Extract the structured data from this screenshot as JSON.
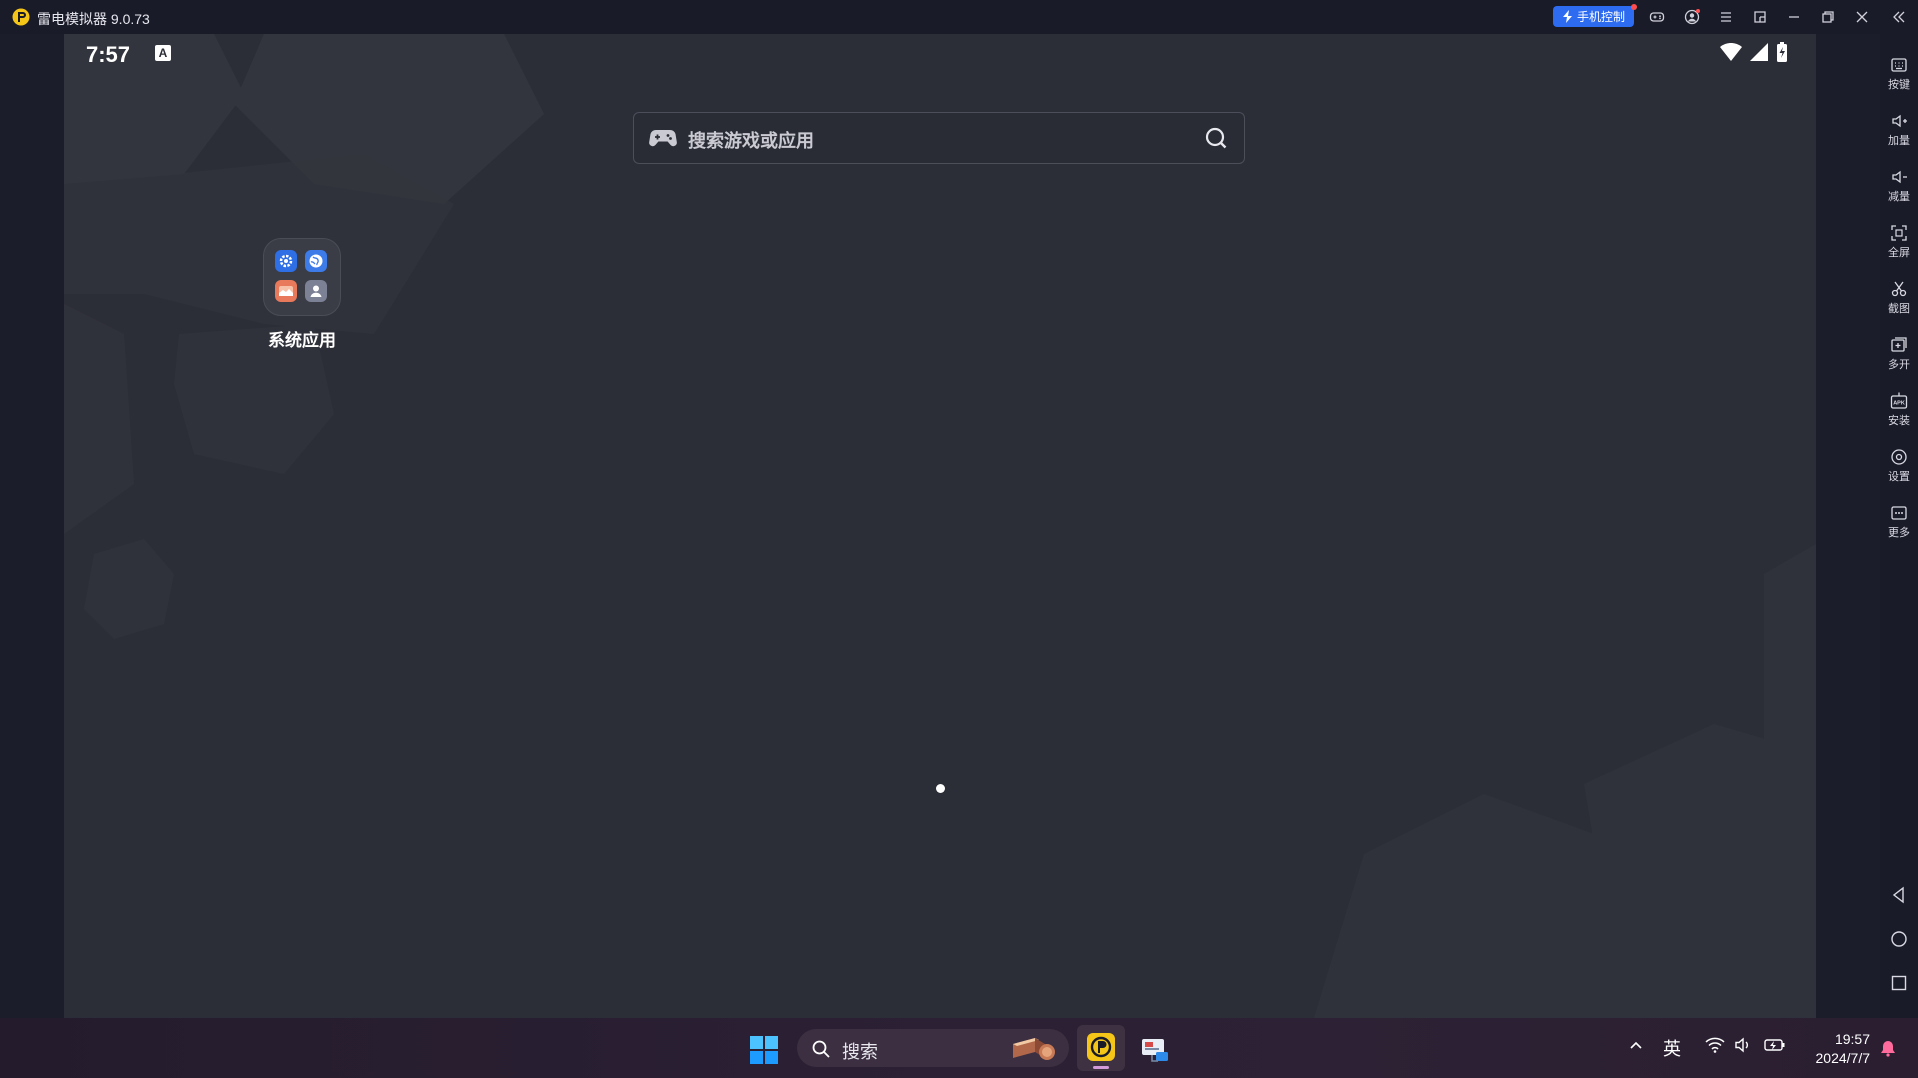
{
  "window": {
    "title": "雷电模拟器 9.0.73",
    "phone_control_label": "手机控制",
    "accent": "#2d6cf0"
  },
  "android": {
    "status_time": "7:57",
    "status_badge": "A",
    "search_placeholder": "搜索游戏或应用",
    "folder_label": "系统应用",
    "folder_apps": [
      "settings-icon",
      "browser-icon",
      "gallery-icon",
      "contacts-icon"
    ]
  },
  "sidebar": {
    "items": [
      {
        "label": "按键",
        "icon": "keyboard-icon"
      },
      {
        "label": "加量",
        "icon": "volume-up-icon"
      },
      {
        "label": "减量",
        "icon": "volume-down-icon"
      },
      {
        "label": "全屏",
        "icon": "fullscreen-icon"
      },
      {
        "label": "截图",
        "icon": "scissors-icon"
      },
      {
        "label": "多开",
        "icon": "multi-instance-icon"
      },
      {
        "label": "安装",
        "icon": "apk-icon"
      },
      {
        "label": "设置",
        "icon": "settings-icon"
      },
      {
        "label": "更多",
        "icon": "more-icon"
      }
    ]
  },
  "taskbar": {
    "search_label": "搜索",
    "ime_label": "英",
    "time": "19:57",
    "date": "2024/7/7"
  }
}
